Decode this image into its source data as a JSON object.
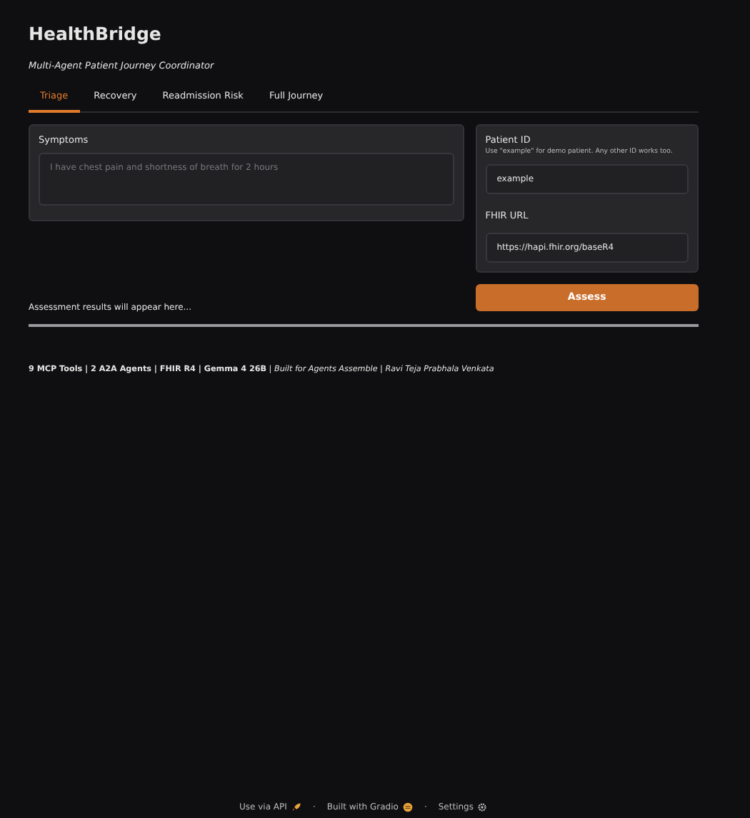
{
  "title": "HealthBridge",
  "subtitle": "Multi-Agent Patient Journey Coordinator",
  "tabs": [
    {
      "label": "Triage",
      "selected": true
    },
    {
      "label": "Recovery",
      "selected": false
    },
    {
      "label": "Readmission Risk",
      "selected": false
    },
    {
      "label": "Full Journey",
      "selected": false
    }
  ],
  "symptoms": {
    "label": "Symptoms",
    "placeholder": "I have chest pain and shortness of breath for 2 hours"
  },
  "patient_id": {
    "label": "Patient ID",
    "info": "Use \"example\" for demo patient. Any other ID works too.",
    "value": "example"
  },
  "fhir_url": {
    "label": "FHIR URL",
    "value": "https://hapi.fhir.org/baseR4"
  },
  "assess_button": "Assess",
  "results": "Assessment results will appear here...",
  "credits": "**9 MCP Tools | 2 A2A Agents | FHIR R4 | Gemma 4 26B** | *Built for Agents Assemble* | *Ravi Teja Prabhala Venkata*",
  "footer": [
    {
      "label": "Use via API",
      "kind": "rocket"
    },
    {
      "label": "Built with Gradio",
      "kind": "logo"
    },
    {
      "label": "Settings",
      "kind": "gear"
    }
  ],
  "footer_separator": "·"
}
